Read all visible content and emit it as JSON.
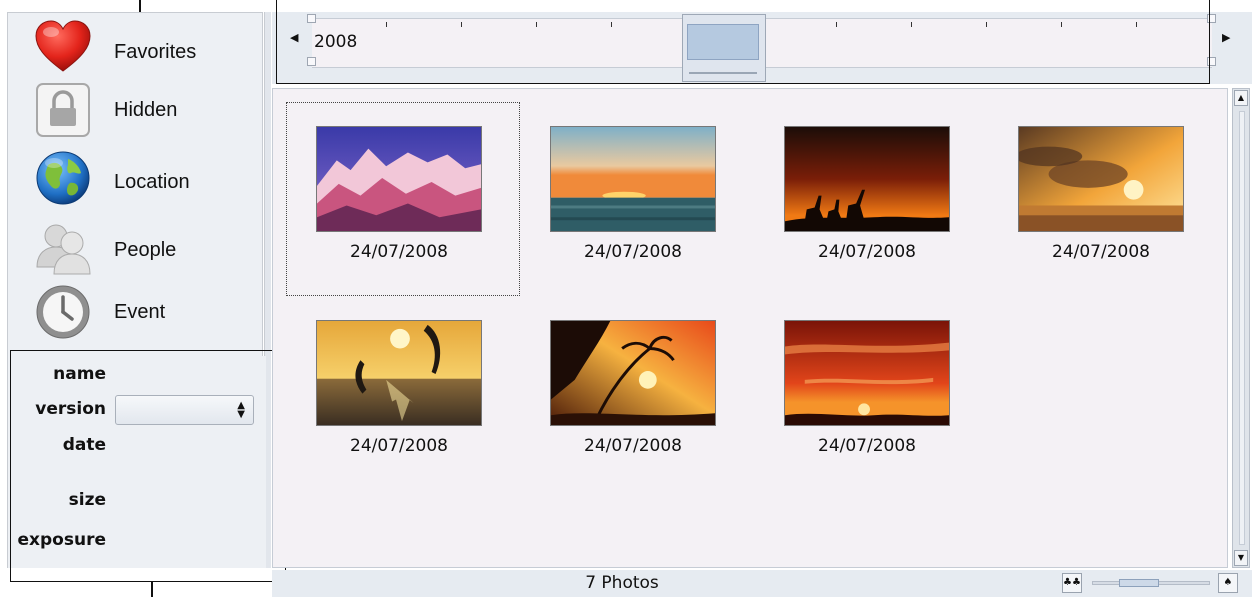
{
  "sidebar": {
    "items": [
      {
        "label": "Favorites",
        "icon": "heart-icon"
      },
      {
        "label": "Hidden",
        "icon": "lock-icon"
      },
      {
        "label": "Location",
        "icon": "globe-icon"
      },
      {
        "label": "People",
        "icon": "people-icon"
      },
      {
        "label": "Event",
        "icon": "clock-icon"
      }
    ]
  },
  "properties": {
    "name_label": "name",
    "version_label": "version",
    "version_value": "",
    "date_label": "date",
    "size_label": "size",
    "exposure_label": "exposure"
  },
  "timeline": {
    "year": "2008"
  },
  "photos": [
    {
      "date": "24/07/2008",
      "scene": "snowy-mountains",
      "selected": true
    },
    {
      "date": "24/07/2008",
      "scene": "ocean-sunset",
      "selected": false
    },
    {
      "date": "24/07/2008",
      "scene": "giraffes-sunset",
      "selected": false
    },
    {
      "date": "24/07/2008",
      "scene": "cloudy-sunset",
      "selected": false
    },
    {
      "date": "24/07/2008",
      "scene": "dolphins-sunset",
      "selected": false
    },
    {
      "date": "24/07/2008",
      "scene": "palm-trees-sunset",
      "selected": false
    },
    {
      "date": "24/07/2008",
      "scene": "red-sky-sunset",
      "selected": false
    }
  ],
  "status": {
    "count_text": "7 Photos",
    "zoom_level": 0.35
  },
  "colors": {
    "panel_bg": "#edf0f4",
    "grid_bg": "#f4f1f5",
    "slider_blue": "#b5c9e0"
  }
}
